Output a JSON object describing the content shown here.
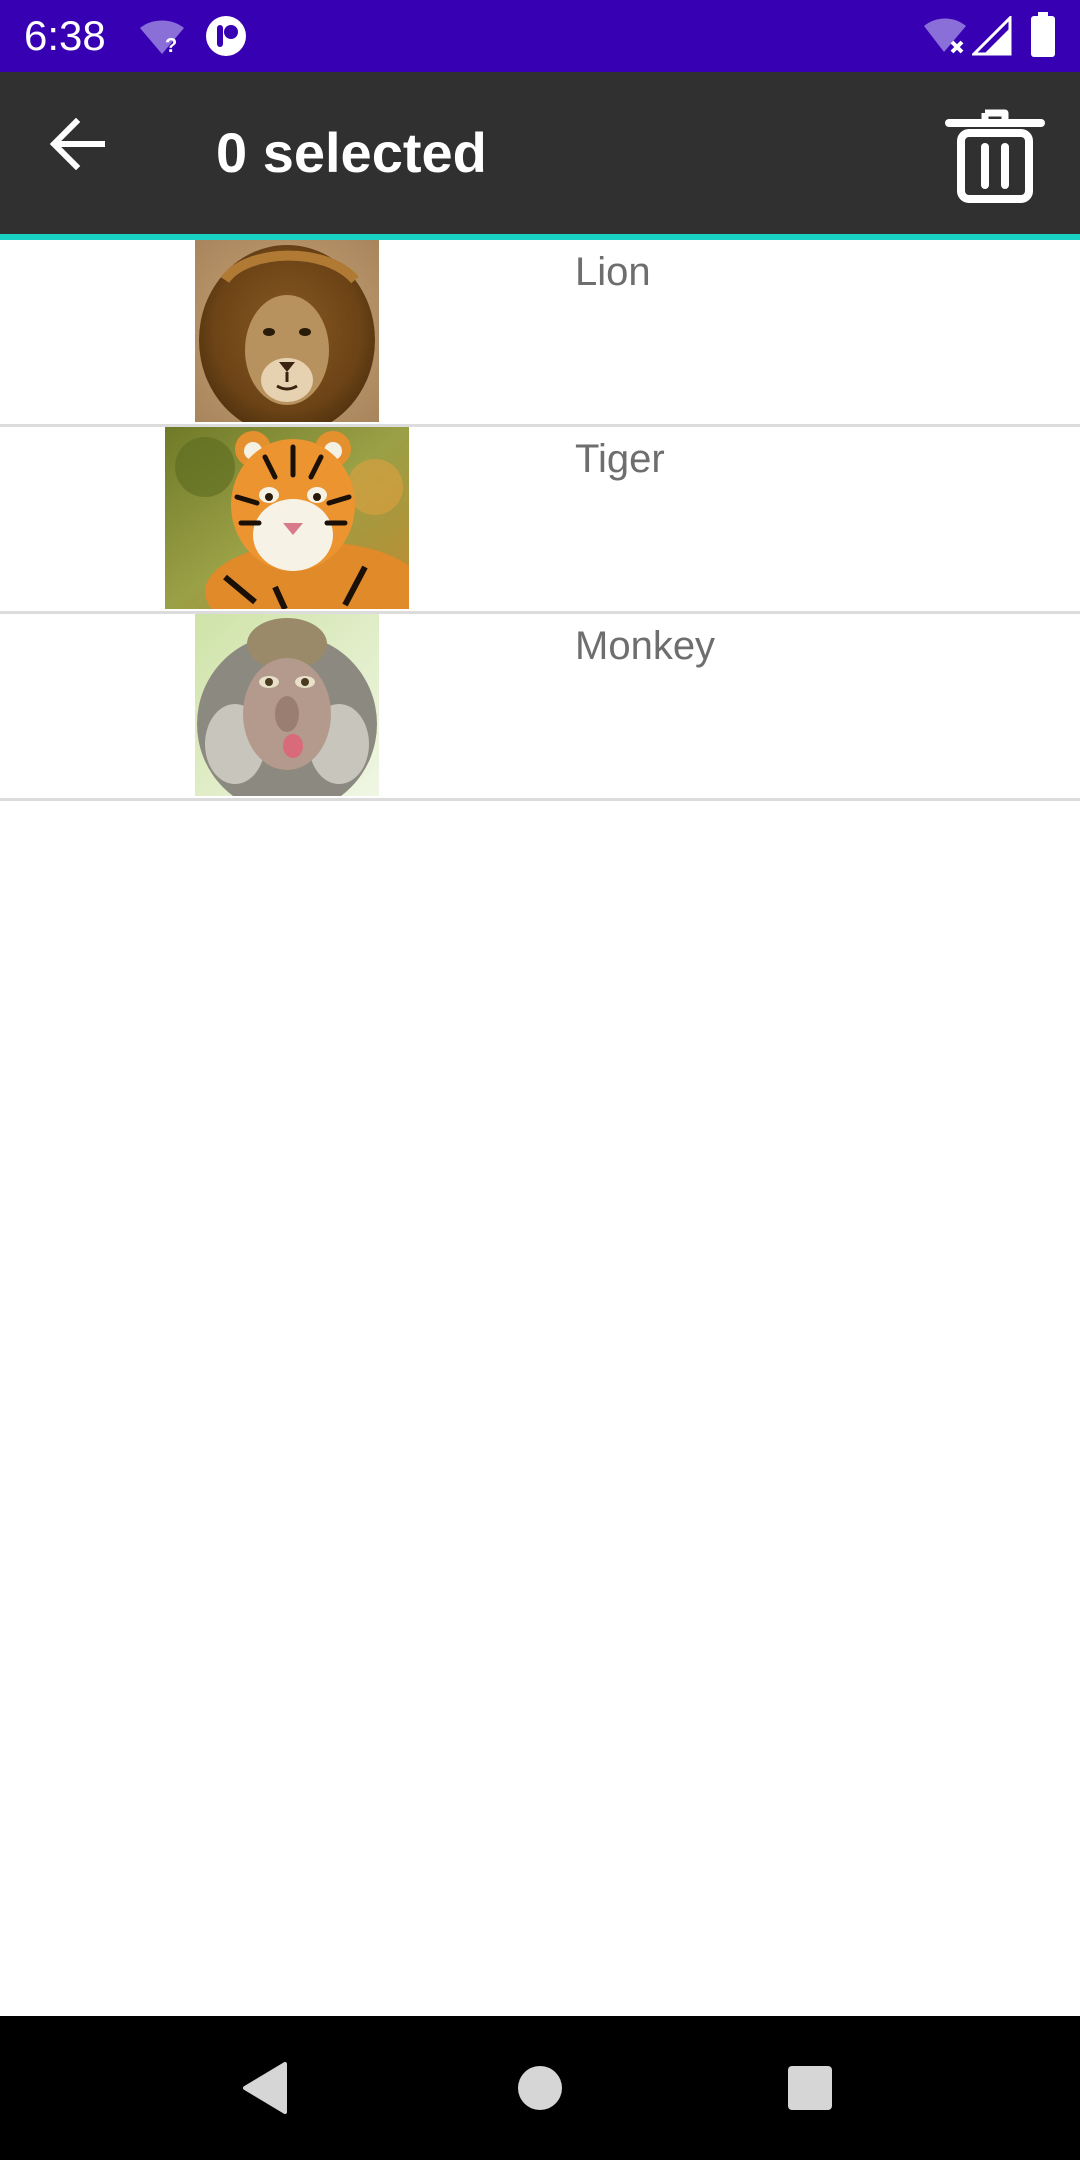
{
  "status_bar": {
    "time": "6:38",
    "background": "#3700b3",
    "icons_left": [
      "wifi-unknown-icon",
      "app-notification-icon"
    ],
    "icons_right": [
      "wifi-no-internet-icon",
      "cell-signal-icon",
      "battery-icon"
    ]
  },
  "toolbar": {
    "title": "0 selected",
    "back_icon": "arrow-back-icon",
    "delete_icon": "trash-icon",
    "background": "#303030",
    "accent": "#18d2c4"
  },
  "animals": [
    {
      "label": "Lion",
      "image": "lion-photo"
    },
    {
      "label": "Tiger",
      "image": "tiger-photo"
    },
    {
      "label": "Monkey",
      "image": "monkey-photo"
    }
  ],
  "nav_bar": {
    "buttons": [
      "back-triangle-icon",
      "home-circle-icon",
      "recents-square-icon"
    ]
  }
}
